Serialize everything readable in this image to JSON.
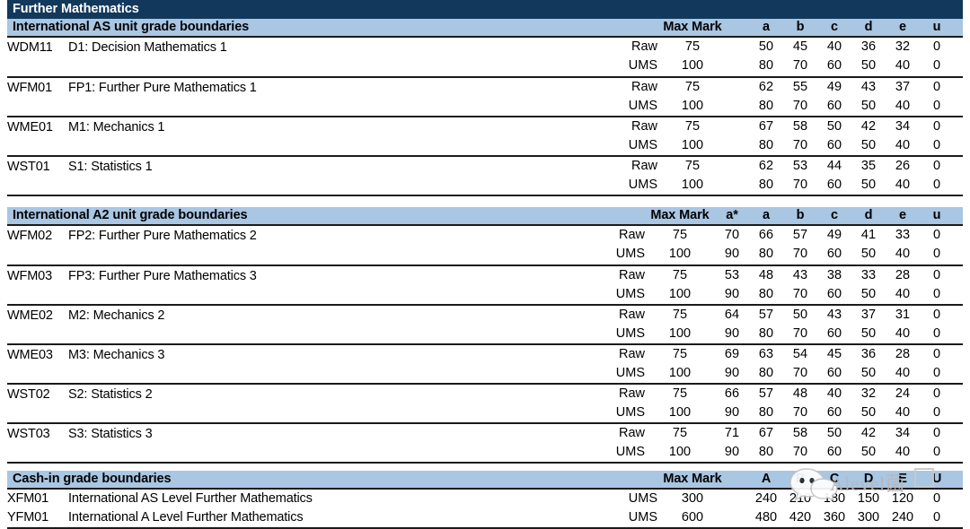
{
  "document": {
    "title": "Further Mathematics"
  },
  "sections": [
    {
      "id": "as-units",
      "title": "International AS unit grade boundaries",
      "max_mark_label": "Max Mark",
      "grade_columns": [
        "a",
        "b",
        "c",
        "d",
        "e",
        "u"
      ],
      "units": [
        {
          "code": "WDM11",
          "name": "D1: Decision Mathematics 1",
          "rows": [
            {
              "type": "Raw",
              "max_mark": "75",
              "values": [
                "50",
                "45",
                "40",
                "36",
                "32",
                "0"
              ]
            },
            {
              "type": "UMS",
              "max_mark": "100",
              "values": [
                "80",
                "70",
                "60",
                "50",
                "40",
                "0"
              ]
            }
          ]
        },
        {
          "code": "WFM01",
          "name": "FP1: Further Pure Mathematics 1",
          "rows": [
            {
              "type": "Raw",
              "max_mark": "75",
              "values": [
                "62",
                "55",
                "49",
                "43",
                "37",
                "0"
              ]
            },
            {
              "type": "UMS",
              "max_mark": "100",
              "values": [
                "80",
                "70",
                "60",
                "50",
                "40",
                "0"
              ]
            }
          ]
        },
        {
          "code": "WME01",
          "name": "M1: Mechanics 1",
          "rows": [
            {
              "type": "Raw",
              "max_mark": "75",
              "values": [
                "67",
                "58",
                "50",
                "42",
                "34",
                "0"
              ]
            },
            {
              "type": "UMS",
              "max_mark": "100",
              "values": [
                "80",
                "70",
                "60",
                "50",
                "40",
                "0"
              ]
            }
          ]
        },
        {
          "code": "WST01",
          "name": "S1: Statistics 1",
          "rows": [
            {
              "type": "Raw",
              "max_mark": "75",
              "values": [
                "62",
                "53",
                "44",
                "35",
                "26",
                "0"
              ]
            },
            {
              "type": "UMS",
              "max_mark": "100",
              "values": [
                "80",
                "70",
                "60",
                "50",
                "40",
                "0"
              ]
            }
          ]
        }
      ]
    },
    {
      "id": "a2-units",
      "title": "International A2 unit grade boundaries",
      "max_mark_label": "Max Mark",
      "grade_columns": [
        "a*",
        "a",
        "b",
        "c",
        "d",
        "e",
        "u"
      ],
      "units": [
        {
          "code": "WFM02",
          "name": "FP2: Further Pure Mathematics 2",
          "rows": [
            {
              "type": "Raw",
              "max_mark": "75",
              "values": [
                "70",
                "66",
                "57",
                "49",
                "41",
                "33",
                "0"
              ]
            },
            {
              "type": "UMS",
              "max_mark": "100",
              "values": [
                "90",
                "80",
                "70",
                "60",
                "50",
                "40",
                "0"
              ]
            }
          ]
        },
        {
          "code": "WFM03",
          "name": "FP3: Further Pure Mathematics 3",
          "rows": [
            {
              "type": "Raw",
              "max_mark": "75",
              "values": [
                "53",
                "48",
                "43",
                "38",
                "33",
                "28",
                "0"
              ]
            },
            {
              "type": "UMS",
              "max_mark": "100",
              "values": [
                "90",
                "80",
                "70",
                "60",
                "50",
                "40",
                "0"
              ]
            }
          ]
        },
        {
          "code": "WME02",
          "name": "M2: Mechanics 2",
          "rows": [
            {
              "type": "Raw",
              "max_mark": "75",
              "values": [
                "64",
                "57",
                "50",
                "43",
                "37",
                "31",
                "0"
              ]
            },
            {
              "type": "UMS",
              "max_mark": "100",
              "values": [
                "90",
                "80",
                "70",
                "60",
                "50",
                "40",
                "0"
              ]
            }
          ]
        },
        {
          "code": "WME03",
          "name": "M3: Mechanics 3",
          "rows": [
            {
              "type": "Raw",
              "max_mark": "75",
              "values": [
                "69",
                "63",
                "54",
                "45",
                "36",
                "28",
                "0"
              ]
            },
            {
              "type": "UMS",
              "max_mark": "100",
              "values": [
                "90",
                "80",
                "70",
                "60",
                "50",
                "40",
                "0"
              ]
            }
          ]
        },
        {
          "code": "WST02",
          "name": "S2: Statistics 2",
          "rows": [
            {
              "type": "Raw",
              "max_mark": "75",
              "values": [
                "66",
                "57",
                "48",
                "40",
                "32",
                "24",
                "0"
              ]
            },
            {
              "type": "UMS",
              "max_mark": "100",
              "values": [
                "90",
                "80",
                "70",
                "60",
                "50",
                "40",
                "0"
              ]
            }
          ]
        },
        {
          "code": "WST03",
          "name": "S3: Statistics 3",
          "rows": [
            {
              "type": "Raw",
              "max_mark": "75",
              "values": [
                "71",
                "67",
                "58",
                "50",
                "42",
                "34",
                "0"
              ]
            },
            {
              "type": "UMS",
              "max_mark": "100",
              "values": [
                "90",
                "80",
                "70",
                "60",
                "50",
                "40",
                "0"
              ]
            }
          ]
        }
      ]
    },
    {
      "id": "cash-in",
      "title": "Cash-in grade boundaries",
      "max_mark_label": "Max Mark",
      "grade_columns": [
        "A",
        "B",
        "C",
        "D",
        "E",
        "U"
      ],
      "qualifications": [
        {
          "code": "XFM01",
          "name": "International AS Level Further Mathematics",
          "type": "UMS",
          "max_mark": "300",
          "values": [
            "240",
            "210",
            "180",
            "150",
            "120",
            "0"
          ]
        },
        {
          "code": "YFM01",
          "name": "International A Level Further Mathematics",
          "type": "UMS",
          "max_mark": "600",
          "values": [
            "480",
            "420",
            "360",
            "300",
            "240",
            "0"
          ]
        }
      ]
    }
  ],
  "watermark": {
    "text": "Alevel菌",
    "icon": "wechat-bubble-icon",
    "badge": "qr-code-icon"
  },
  "colors": {
    "title_bar": "#12395c",
    "section_header": "#a9c6e3",
    "rule": "#1a1a1a",
    "text": "#000000",
    "watermark": "#b9b9b9"
  }
}
